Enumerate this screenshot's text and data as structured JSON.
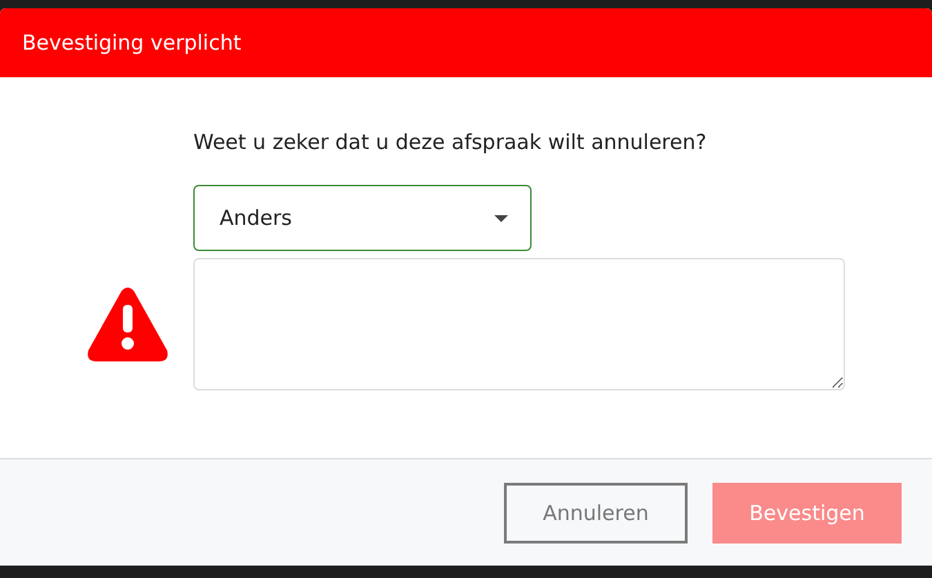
{
  "dialog": {
    "title": "Bevestiging verplicht",
    "question": "Weet u zeker dat u deze afspraak wilt annuleren?",
    "reason_select": {
      "value": "Anders"
    },
    "buttons": [
      {
        "label": "Annuleren",
        "kind": "secondary",
        "disabled": false
      },
      {
        "label": "Bevestigen",
        "kind": "primary",
        "disabled": true
      }
    ]
  }
}
